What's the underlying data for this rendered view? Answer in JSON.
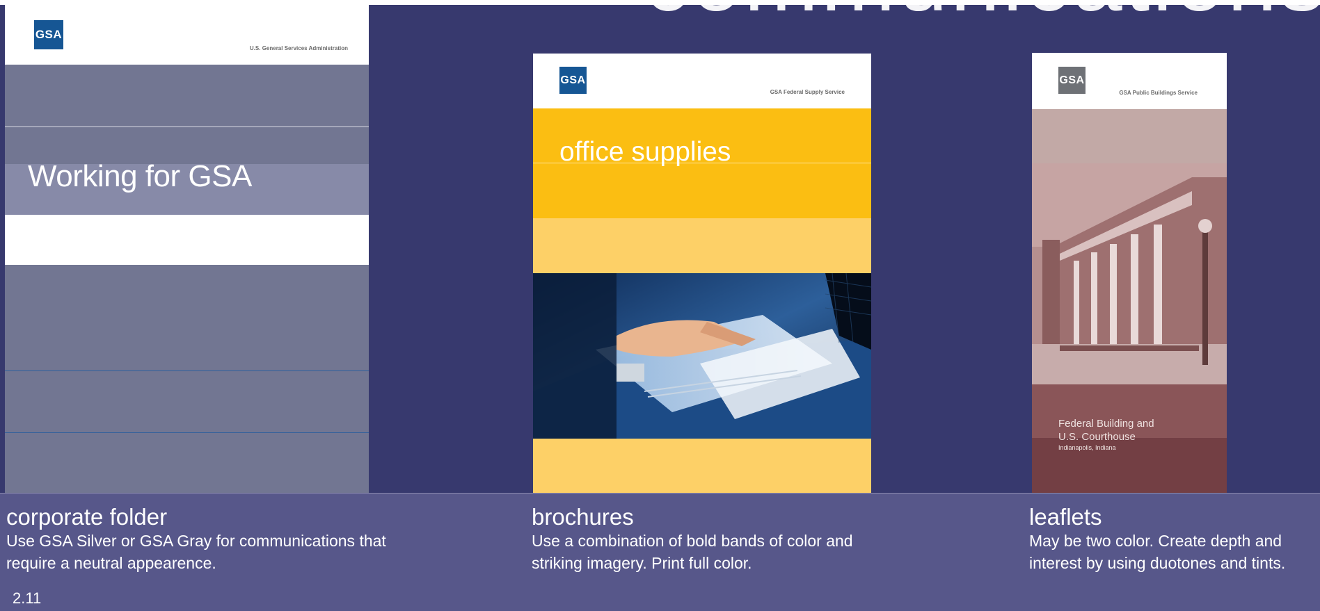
{
  "page": {
    "section_title": "communications",
    "page_number": "2.11"
  },
  "folder": {
    "logo": "GSA",
    "agency": "U.S. General Services Administration",
    "title": "Working for GSA",
    "caption_title": "corporate folder",
    "caption_text": "Use GSA Silver or GSA Gray for communications that require a neutral appearence."
  },
  "brochure": {
    "logo": "GSA",
    "agency": "GSA Federal Supply Service",
    "title": "office supplies",
    "caption_title": "brochures",
    "caption_text": "Use a combination of bold bands of color and striking imagery. Print full color."
  },
  "leaflet": {
    "logo": "GSA",
    "agency": "GSA Public Buildings Service",
    "building_line1": "Federal Building and",
    "building_line2": "U.S. Courthouse",
    "location": "Indianapolis, Indiana",
    "caption_title": "leaflets",
    "caption_text": "May be two color. Create depth and interest by using duotones and tints."
  },
  "colors": {
    "gsa_blue": "#165694",
    "navy_band": "#37396e",
    "caption_band": "#57578a",
    "gsa_silver": "#727692",
    "brochure_yellow": "#fbbe12",
    "leaflet_rose": "#8a5558"
  }
}
